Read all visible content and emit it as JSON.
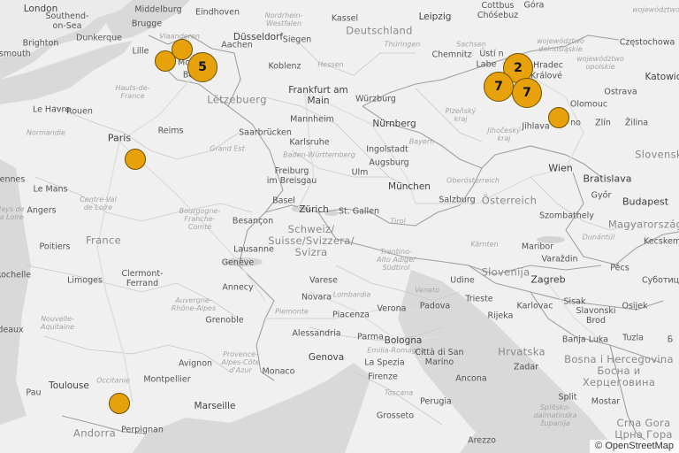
{
  "attribution": "© OpenStreetMap",
  "colors": {
    "marker_fill": "#e6a10b",
    "marker_stroke": "#6f5200",
    "land": "#f0f0f0",
    "water": "#d7d7d7",
    "border": "#9a9a9a"
  },
  "labels": {
    "london": "London",
    "southend": "Southend-\non-Sea",
    "brighton": "Brighton",
    "portsmouth": "rtsmouth",
    "dunkerque": "Dunkerque",
    "middelburg": "Middelburg",
    "brugge": "Brugge",
    "eindhoven": "Eindhoven",
    "lille": "Lille",
    "vlaanderen": "Vlaanderen",
    "mons": "Mo",
    "bru": "Be",
    "bru2": "Bru",
    "aachen": "Aachen",
    "dusseldorf": "Düsseldorf",
    "nrw": "Nordrhein-\nWestfalen",
    "siegen": "Siegen",
    "koblenz": "Koblenz",
    "kassel": "Kassel",
    "deutschland": "Deutschland",
    "thuringen": "Thüringen",
    "hessen": "Hessen",
    "leipzig": "Leipzig",
    "cottbus": "Cottbus\nChóśebuz",
    "gora": "Góra",
    "wojewodztwo": "województwo",
    "sachsen": "Sachsen",
    "chemnitz": "Chemnitz",
    "usti": "Ústí n",
    "labem": "Labe",
    "hradec": "Hradec",
    "kralove": "Králové",
    "woj_dolno": "województwo\ndolnośląskie",
    "woj_opol": "województwo\nopolskie",
    "czestochowa": "Częstochowa",
    "katowice": "Katowic",
    "haute_france": "Hauts-de-\nFrance",
    "letzebuerg": "Lëtzebuerg",
    "frankfurt": "Frankfurt am\nMain",
    "wurzburg": "Würzburg",
    "plzensky": "Plzeňský\nkraj",
    "olomouc": "Olomouc",
    "ostrava": "Ostrava",
    "le_havre": "Le Havre",
    "rouen": "Rouen",
    "normandie": "Normandie",
    "reims": "Reims",
    "saarbrucken": "Saarbrücken",
    "mannheim": "Mannheim",
    "nurnberg": "Nürnberg",
    "jihocesky": "Jihočeský\nkraj",
    "jihlava": "Jihlava",
    "brno": "no",
    "zlin": "Zlín",
    "zilina": "Žilina",
    "paris": "Paris",
    "grand_est": "Grand Est",
    "karlsruhe": "Karlsruhe",
    "bw": "Baden-Württemberg",
    "ingolstadt": "Ingolstadt",
    "bayern": "Bayern",
    "augsburg": "Augsburg",
    "wien": "Wien",
    "slovensko": "Slovensk",
    "rennes": "ennes",
    "le_mans": "Le Mans",
    "freiburg": "Freiburg\nim Breisgau",
    "ulm": "Ulm",
    "munchen": "München",
    "oberosterreich": "Oberösterreich",
    "bratislava": "Bratislava",
    "gyor": "Győr",
    "pays_loire": "Pays de\nla Loire",
    "angers": "Angers",
    "centre": "Centre-Val\nde Loire",
    "basel": "Basel",
    "zurich": "Zürich",
    "stgallen": "St. Gallen",
    "salzburg": "Salzburg",
    "osterreich": "Österreich",
    "budapest": "Budapest",
    "bourgogne": "Bourgogne-\nFranche-\nComté",
    "besancon": "Besançon",
    "tirol": "Tirol",
    "szombathely": "Szombathely",
    "magyarorszag": "Magyarország",
    "france": "France",
    "schweiz": "Schweiz/\nSuisse/Svizzera/\nSvizra",
    "karnten": "Kärnten",
    "dunantul": "Dunántúl",
    "kecskemet": "Kecskemé",
    "poitiers": "Poitiers",
    "lausanne": "Lausanne",
    "maribor": "Maribor",
    "trentino": "Trentino-\nAlto Adige/\nSüdtirol",
    "varazdin": "Varaždin",
    "pecs": "Pécs",
    "rochelle": "Rochelle",
    "clermont": "Clermont-\nFerrand",
    "geneve": "Genève",
    "slovenija": "Slovenija",
    "limoges": "Limoges",
    "annecy": "Annecy",
    "varese": "Varese",
    "udine": "Udine",
    "zagreb": "Zagreb",
    "subotica": "Суботица",
    "lombardia": "Lombardia",
    "veneto": "Veneto",
    "novara": "Novara",
    "padova": "Padova",
    "trieste": "Trieste",
    "karlovac": "Karlovac",
    "sisak": "Sisak",
    "osijek": "Osijek",
    "piemonte": "Piemonte",
    "milano": "Milano",
    "nouvelle_aquitaine": "Nouvelle-\nAquitaine",
    "ara": "Auvergne-\nRhône-Alpes",
    "grenoble": "Grenoble",
    "piacenza": "Piacenza",
    "verona": "Verona",
    "rijeka": "Rijeka",
    "slavonski": "Slavonski\nBrod",
    "deaux": "deaux",
    "alessandria": "Alessandria",
    "parma": "Parma",
    "bologna": "Bologna",
    "banja_luka": "Banja Luka",
    "tuzla": "Tuzla",
    "emilia": "Emilia-Romagna",
    "genova": "Genova",
    "sanmarino": "Città di San\nMarino",
    "hrvatska": "Hrvatska",
    "zadar": "Zadar",
    "bih": "Bosna i Hercegovina\nБосна и\nХерцеговина",
    "avignon": "Avignon",
    "paca": "Provence-\nAlpes-Côte\nd'Azur",
    "monaco": "Monaco",
    "laspezia": "La Spezia",
    "toulouse": "Toulouse",
    "occitanie": "Occitanie",
    "montpellier": "Montpellier",
    "toscana": "Toscana",
    "firenze": "Firenze",
    "ancona": "Ancona",
    "pau": "Pau",
    "marseille": "Marseille",
    "grosseto": "Grosseto",
    "perugia": "Perugia",
    "split": "Split",
    "splitska": "Splitsko-\ndalmatinska\nžupanija",
    "mostar": "Mostar",
    "crna_gora": "Crna Gora\nЦрна Гора",
    "andorra": "Andorra",
    "perpignan": "Perpignan",
    "arezzo": "Arezzo",
    "be_short": "Б"
  },
  "markers": [
    {
      "id": "marker-flanders-1",
      "count": ""
    },
    {
      "id": "marker-flanders-2",
      "count": ""
    },
    {
      "id": "cluster-brussels",
      "count": "5"
    },
    {
      "id": "cluster-hradec",
      "count": "2"
    },
    {
      "id": "cluster-pardubice",
      "count": "7"
    },
    {
      "id": "cluster-chrudim",
      "count": "7"
    },
    {
      "id": "marker-brno",
      "count": ""
    },
    {
      "id": "marker-paris-south",
      "count": ""
    },
    {
      "id": "marker-toulouse-east",
      "count": ""
    }
  ]
}
